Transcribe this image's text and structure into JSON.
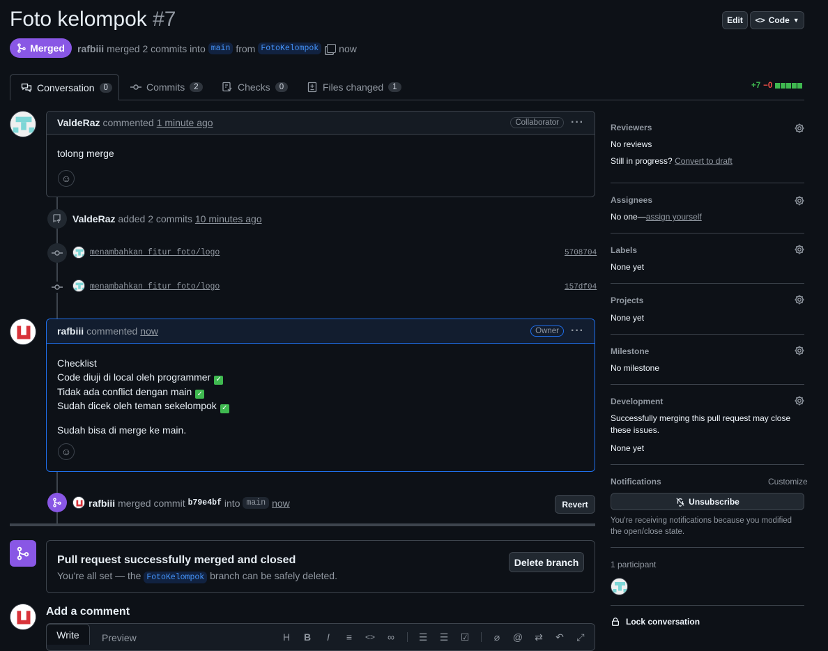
{
  "pr": {
    "title": "Foto kelompok",
    "number": "#7",
    "state_label": "Merged",
    "author": "rafbiii",
    "summary_merged": "merged 2 commits into",
    "base_branch": "main",
    "from_text": "from",
    "head_branch": "FotoKelompok",
    "time": "now"
  },
  "header_buttons": {
    "edit": "Edit",
    "code": "Code"
  },
  "tabs": [
    {
      "label": "Conversation",
      "count": "0",
      "icon": "comment-discussion-icon"
    },
    {
      "label": "Commits",
      "count": "2",
      "icon": "git-commit-icon"
    },
    {
      "label": "Checks",
      "count": "0",
      "icon": "checklist-icon"
    },
    {
      "label": "Files changed",
      "count": "1",
      "icon": "file-diff-icon"
    }
  ],
  "diffstat": {
    "added": "+7",
    "removed": "−0"
  },
  "comment1": {
    "author": "ValdeRaz",
    "action": "commented",
    "time": "1 minute ago",
    "role": "Collaborator",
    "body": "tolong merge"
  },
  "commits_event": {
    "author": "ValdeRaz",
    "action": "added 2 commits",
    "time": "10 minutes ago",
    "commits": [
      {
        "message": "menambahkan fitur foto/logo",
        "sha": "5708704"
      },
      {
        "message": "menambahkan fitur foto/logo",
        "sha": "157df04"
      }
    ]
  },
  "comment2": {
    "author": "rafbiii",
    "action": "commented",
    "time": "now",
    "role": "Owner",
    "line1": "Checklist",
    "line2": "Code diuji di local oleh programmer",
    "line3": "Tidak ada conflict dengan main",
    "line4": "Sudah dicek oleh teman sekelompok",
    "line5": "Sudah bisa di merge ke main."
  },
  "merge_event": {
    "author": "rafbiii",
    "action": "merged commit",
    "sha": "b79e4bf",
    "into": "into",
    "branch": "main",
    "time": "now",
    "revert": "Revert"
  },
  "merged_box": {
    "title": "Pull request successfully merged and closed",
    "text_before": "You're all set — the",
    "branch": "FotoKelompok",
    "text_after": "branch can be safely deleted.",
    "delete_button": "Delete branch"
  },
  "add_comment": {
    "title": "Add a comment",
    "write_tab": "Write",
    "preview_tab": "Preview"
  },
  "sidebar": {
    "reviewers_title": "Reviewers",
    "reviewers_value": "No reviews",
    "in_progress": "Still in progress?",
    "convert_to_draft": "Convert to draft",
    "assignees_title": "Assignees",
    "assignees_value": "No one—",
    "assign_yourself": "assign yourself",
    "labels_title": "Labels",
    "labels_value": "None yet",
    "projects_title": "Projects",
    "projects_value": "None yet",
    "milestone_title": "Milestone",
    "milestone_value": "No milestone",
    "development_title": "Development",
    "development_text": "Successfully merging this pull request may close these issues.",
    "development_value": "None yet",
    "notifications_title": "Notifications",
    "customize": "Customize",
    "unsubscribe": "Unsubscribe",
    "notifications_reason": "You're receiving notifications because you modified the open/close state.",
    "participants": "1 participant",
    "lock": "Lock conversation"
  },
  "colors": {
    "merged_purple": "#8957e5",
    "link_blue": "#4493f8",
    "add_green": "#3fb950",
    "remove_red": "#f85149"
  }
}
